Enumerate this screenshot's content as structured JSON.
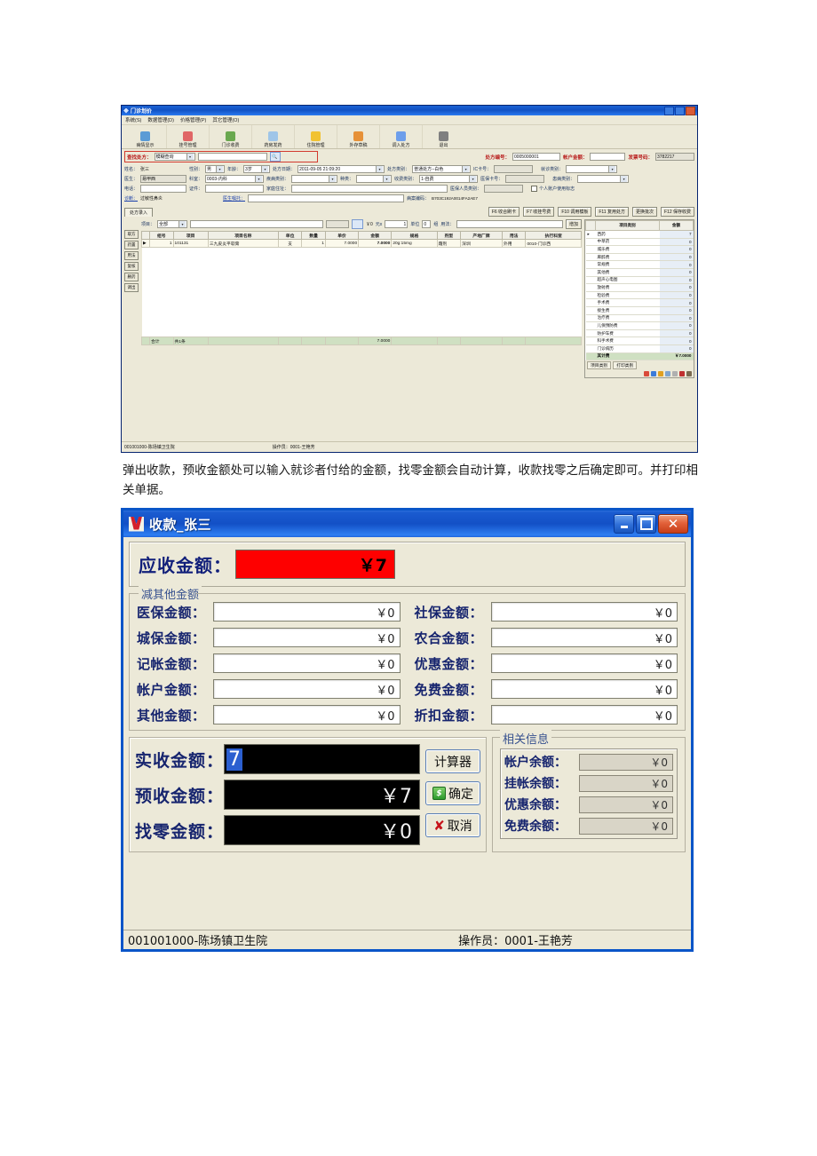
{
  "top_window": {
    "title": "门诊划价",
    "menus": [
      "系统(S)",
      "数据管理(D)",
      "价格管理(P)",
      "其它管理(O)"
    ],
    "toolbar": [
      {
        "label": "病情显示",
        "color": "#5b9bd5"
      },
      {
        "label": "挂号管理",
        "color": "#e06666"
      },
      {
        "label": "门诊收费",
        "color": "#6aa84f"
      },
      {
        "label": "药房发药",
        "color": "#9fc5e8"
      },
      {
        "label": "住院管理",
        "color": "#f1c232"
      },
      {
        "label": "外存草稿",
        "color": "#e69138"
      },
      {
        "label": "调入处方",
        "color": "#6d9eeb"
      },
      {
        "label": "退出",
        "color": "#7f7f7f"
      }
    ],
    "search": {
      "label": "查找处方：",
      "mode": "模糊查询",
      "value": "",
      "find_icon": "magnifier-icon"
    },
    "header_fields": [
      {
        "label": "处方编号：",
        "value": "0005000001"
      },
      {
        "label": "帐户金额：",
        "value": ""
      },
      {
        "label": "发票号码：",
        "value": "3782217"
      }
    ],
    "form": {
      "name_label": "姓名：",
      "name_value": "张三",
      "sex_label": "性别：",
      "sex_value": "男",
      "age_label": "年龄：",
      "age_value": "3岁",
      "rx_date_label": "处方日期：",
      "rx_date_value": "2011-09-05 21:09:20",
      "rx_type_label": "处方类别：",
      "rx_type_value": "普通处方--白色",
      "ic_label": "IC卡号：",
      "ic_value": "",
      "visit_type_label": "就诊类别：",
      "visit_type_value": "",
      "doctor_label": "医生：",
      "doctor_value": "易甲西",
      "dept_label": "科室：",
      "dept_value": "0003-内科",
      "disease_label": "疾病类别：",
      "disease_value": "",
      "kind_label": "种类：",
      "kind_value": "",
      "fee_type_label": "收费类别：",
      "fee_type_value": "1-自费",
      "medcard_label": "医保卡号：",
      "medcard_value": "",
      "ill_type_label": "患病类别：",
      "ill_type_value": "",
      "phone_label": "电话：",
      "phone_value": "",
      "id_label": "证件：",
      "id_value": "",
      "addr_label": "家庭住址：",
      "addr_value": "",
      "medstaff_label": "医保人员类别：",
      "medstaff_value": "",
      "personal_checkbox": "个人账户使用标志",
      "diag_label": "诊断：",
      "diag_value": "过敏性鼻炎",
      "advice_label": "医生嘱托：",
      "advice_value": "",
      "case_label": "病案编码：",
      "case_value": "B703C192A0014FA2AE7"
    },
    "tab_label": "处方录入",
    "fn_buttons": [
      "F6 收合刷卡",
      "F7 收挂号费",
      "F10 调用模板",
      "F11 复用处方",
      "更换批次",
      "F12 保存收费"
    ],
    "grid_side_buttons": [
      "取方",
      "药置",
      "用法",
      "复核",
      "删药",
      "调出"
    ],
    "item_bar": {
      "label": "项目：",
      "scope": "全部",
      "value": "",
      "amount_label": "￥0",
      "unit_label": "元x",
      "qty": "1",
      "unit_word": "单位",
      "unit_value": "0",
      "group_word": "组",
      "usage_label": "用法：",
      "usage_value": "",
      "add_button": "增加"
    },
    "table": {
      "columns": [
        "",
        "组号",
        "项目",
        "项目名称",
        "单位",
        "数量",
        "单价",
        "金额",
        "规格",
        "剂型",
        "产地厂牌",
        "用法",
        "执行科室"
      ],
      "rows": [
        {
          "cells": [
            "▶",
            "1",
            "101131",
            "三九皮炎平软膏",
            "支",
            "1",
            "7.0000",
            "7.0000",
            "20g:15mg",
            "霜剂",
            "深圳",
            "外用",
            "0010-门诊西"
          ]
        }
      ],
      "summary": [
        "",
        "合计",
        "共1条",
        "",
        "",
        "",
        "",
        "7.0000",
        "",
        "",
        "",
        "",
        ""
      ]
    },
    "category_panel": {
      "columns": [
        "",
        "项目类别",
        "金额"
      ],
      "rows": [
        {
          "name": "西药",
          "value": "7"
        },
        {
          "name": "中草药",
          "value": "0"
        },
        {
          "name": "城乐费",
          "value": "0"
        },
        {
          "name": "麻醉费",
          "value": "0"
        },
        {
          "name": "常规费",
          "value": "0"
        },
        {
          "name": "其他费",
          "value": "0"
        },
        {
          "name": "超声心电图",
          "value": "0"
        },
        {
          "name": "放射费",
          "value": "0"
        },
        {
          "name": "检验费",
          "value": "0"
        },
        {
          "name": "手术费",
          "value": "0"
        },
        {
          "name": "接生费",
          "value": "0"
        },
        {
          "name": "治疗费",
          "value": "0"
        },
        {
          "name": "儿保预防费",
          "value": "0"
        },
        {
          "name": "防护车费",
          "value": "0"
        },
        {
          "name": "科手术费",
          "value": "0"
        },
        {
          "name": "门诊病历",
          "value": "0"
        }
      ],
      "total": {
        "name": "其计费",
        "value": "￥7.0000"
      },
      "tabs": [
        "项目类别",
        "打印类别"
      ]
    },
    "status": {
      "left": "001001000-陈场镇卫生院",
      "right": "操作员：0001-王艳芳"
    }
  },
  "paragraph": "弹出收款，预收金额处可以输入就诊者付给的金额，找零金额会自动计算，收款找零之后确定即可。并打印相关单据。",
  "dialog": {
    "title": "收款_张三",
    "window_buttons": {
      "minimize": "minimize-icon",
      "maximize": "maximize-icon",
      "close": "close-icon"
    },
    "receivable": {
      "label": "应收金额：",
      "value": "￥7"
    },
    "deductions_group_title": "减其他金额",
    "deductions": [
      {
        "label": "医保金额：",
        "value": "￥0"
      },
      {
        "label": "社保金额：",
        "value": "￥0"
      },
      {
        "label": "城保金额：",
        "value": "￥0"
      },
      {
        "label": "农合金额：",
        "value": "￥0"
      },
      {
        "label": "记帐金额：",
        "value": "￥0"
      },
      {
        "label": "优惠金额：",
        "value": "￥0"
      },
      {
        "label": "帐户金额：",
        "value": "￥0"
      },
      {
        "label": "免费金额：",
        "value": "￥0"
      },
      {
        "label": "其他金额：",
        "value": "￥0"
      },
      {
        "label": "折扣金额：",
        "value": "￥0"
      }
    ],
    "payment": {
      "actual_label": "实收金额：",
      "actual_value": "7",
      "prepaid_label": "预收金额：",
      "prepaid_value": "￥7",
      "change_label": "找零金额：",
      "change_value": "￥0"
    },
    "buttons": {
      "calculator": "计算器",
      "confirm": "确定",
      "confirm_icon": "money-icon",
      "cancel": "取消",
      "cancel_icon": "x-icon"
    },
    "related_info": {
      "title": "相关信息",
      "rows": [
        {
          "label": "帐户余额：",
          "value": "￥0"
        },
        {
          "label": "挂帐余额：",
          "value": "￥0"
        },
        {
          "label": "优惠余额：",
          "value": "￥0"
        },
        {
          "label": "免费余额：",
          "value": "￥0"
        }
      ]
    },
    "status": {
      "left": "001001000-陈场镇卫生院",
      "right": "操作员：0001-王艳芳"
    }
  }
}
